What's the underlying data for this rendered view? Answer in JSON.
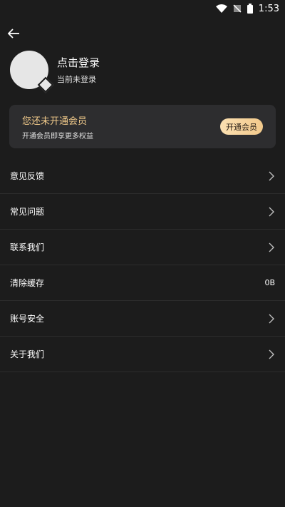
{
  "status_bar": {
    "time": "1:53",
    "icons": [
      "wifi-icon",
      "no-signal-icon",
      "battery-icon"
    ]
  },
  "header": {
    "back_icon": "arrow-left-icon"
  },
  "profile": {
    "login_title": "点击登录",
    "login_status": "当前未登录"
  },
  "vip": {
    "title": "您还未开通会员",
    "subtitle": "开通会员即享更多权益",
    "button_label": "开通会员",
    "accent_color": "#f0c98a"
  },
  "menu": {
    "items": [
      {
        "label": "意见反馈",
        "trailing": "chevron-right-icon"
      },
      {
        "label": "常见问题",
        "trailing": "chevron-right-icon"
      },
      {
        "label": "联系我们",
        "trailing": "chevron-right-icon"
      },
      {
        "label": "清除缓存",
        "value": "0B"
      },
      {
        "label": "账号安全",
        "trailing": "chevron-right-icon"
      },
      {
        "label": "关于我们",
        "trailing": "chevron-right-icon"
      }
    ]
  }
}
